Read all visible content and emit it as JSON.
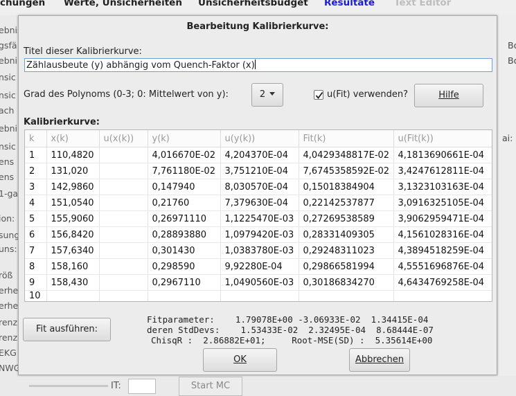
{
  "background": {
    "menu": [
      "chungen",
      "Werte, Unsicherheiten",
      "Unsicherheitsbudget",
      "Resultate",
      "Text Editor"
    ],
    "menu_active_color": "#1a1adb",
    "menu_disabled_color": "#bdbdbd",
    "left_labels": [
      "ebnis",
      "gsfä",
      "ebni",
      "nsic",
      "nsic",
      "ach",
      "ebni",
      "nsic",
      "ens",
      "ens",
      "1-ga",
      "ion:",
      "sung",
      "uns:",
      "röß",
      "erhe",
      "erhe",
      "renz",
      "renz",
      "EKG",
      "NWG"
    ],
    "right_labels": [
      "Bo",
      "Bo",
      "ai:"
    ],
    "it_label": "IT:",
    "start_mc": "Start MC"
  },
  "dialog": {
    "title": "Bearbeitung Kalibrierkurve:",
    "title_label": "Titel dieser Kalibrierkurve:",
    "title_value": "Zählausbeute (y) abhängig vom Quench-Faktor (x)",
    "degree_label": "Grad des Polynoms (0-3; 0: Mittelwert von y):",
    "degree_value": "2",
    "use_fit_label": "u(Fit) verwenden?",
    "use_fit_checked": true,
    "help_button": "Hilfe",
    "curve_label": "Kalibrierkurve:",
    "fit_button": "Fit ausführen:",
    "fit_lines": [
      "Fitparameter:    1.79078E+00 -3.06933E-02  1.34415E-04",
      "deren StdDevs:    1.53433E-02  2.32495E-04  8.68444E-07",
      "ChisqR :  2.86882E+01;     Root-MSE(SD) :  5.35614E+00"
    ],
    "ok_button": "OK",
    "cancel_button": "Abbrechen"
  },
  "table": {
    "columns": [
      "k",
      "x(k)",
      "u(x(k))",
      "y(k)",
      "u(y(k))",
      "Fit(k)",
      "u(Fit(k))"
    ],
    "rows": [
      [
        "1",
        "110,4820",
        "",
        "4,016670E-02",
        "4,204370E-04",
        "4,0429348817E-02",
        "4,1813690661E-04"
      ],
      [
        "2",
        "131,020",
        "",
        "7,761180E-02",
        "3,751210E-04",
        "7,6745358592E-02",
        "3,4247612811E-04"
      ],
      [
        "3",
        "142,9860",
        "",
        "0,147940",
        "8,030570E-04",
        "0,15018384904",
        "3,1323103163E-04"
      ],
      [
        "4",
        "151,0540",
        "",
        "0,21760",
        "7,379630E-04",
        "0,22142537877",
        "3,0916325105E-04"
      ],
      [
        "5",
        "155,9060",
        "",
        "0,26971110",
        "1,1225470E-03",
        "0,27269538589",
        "3,9062959471E-04"
      ],
      [
        "6",
        "156,8420",
        "",
        "0,28893880",
        "1,0979420E-03",
        "0,28331409305",
        "4,1561028316E-04"
      ],
      [
        "7",
        "157,6340",
        "",
        "0,301430",
        "1,0383780E-03",
        "0,29248311023",
        "4,3894518259E-04"
      ],
      [
        "8",
        "158,160",
        "",
        "0,298590",
        "9,92280E-04",
        "0,29866581994",
        "4,5551696876E-04"
      ],
      [
        "9",
        "158,430",
        "",
        "0,2967110",
        "1,0490560E-03",
        "0,30186834270",
        "4,6434769258E-04"
      ],
      [
        "10",
        "",
        "",
        "",
        "",
        "",
        ""
      ]
    ]
  }
}
